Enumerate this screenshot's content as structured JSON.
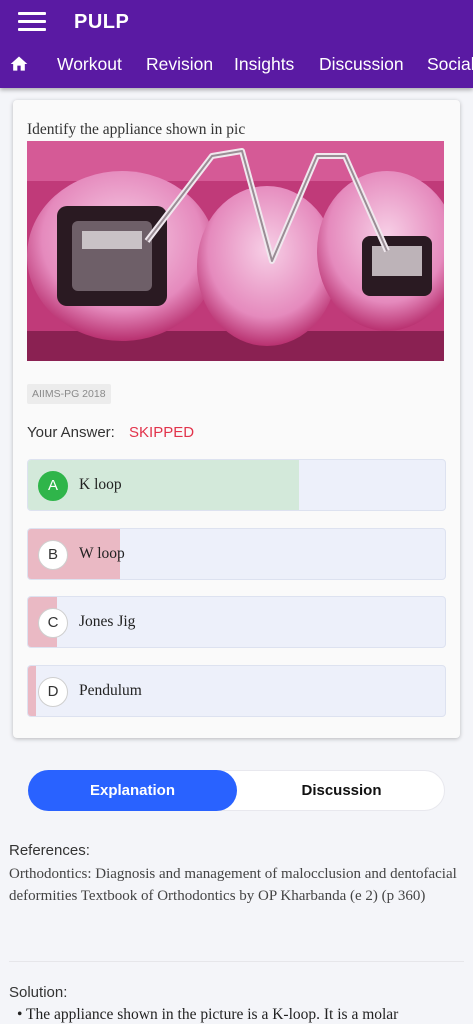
{
  "app": {
    "title": "PULP"
  },
  "nav": {
    "home_icon": "home-icon",
    "tabs": [
      "Workout",
      "Revision",
      "Insights",
      "Discussion",
      "Social"
    ]
  },
  "question": {
    "text": "Identify the appliance shown in pic",
    "image": "photo of K-loop orthodontic appliance on teeth",
    "tag": "AIIMS-PG 2018",
    "your_answer_label": "Your Answer:",
    "your_answer_value": "SKIPPED",
    "options": [
      {
        "letter": "A",
        "text": "K loop",
        "correct": true,
        "percent": 65
      },
      {
        "letter": "B",
        "text": "W loop",
        "correct": false,
        "percent": 22
      },
      {
        "letter": "C",
        "text": "Jones Jig",
        "correct": false,
        "percent": 7
      },
      {
        "letter": "D",
        "text": "Pendulum",
        "correct": false,
        "percent": 2
      }
    ]
  },
  "segment": {
    "active": "Explanation",
    "inactive": "Discussion"
  },
  "explanation": {
    "references_label": "References:",
    "references_text": "Orthodontics: Diagnosis and management of malocclusion and dentofacial deformities Textbook of Orthodontics by OP Kharbanda (e 2) (p 360)",
    "solution_label": "Solution:",
    "solution_text": "• The appliance shown in the picture is a K-loop. It is a molar"
  },
  "colors": {
    "appbar": "#5a1aa3",
    "accent": "#2962ff",
    "skipped": "#e2334b",
    "correct_fill": "#d3e9da",
    "wrong_fill": "#eab9c4",
    "correct_badge": "#2fb54a"
  }
}
